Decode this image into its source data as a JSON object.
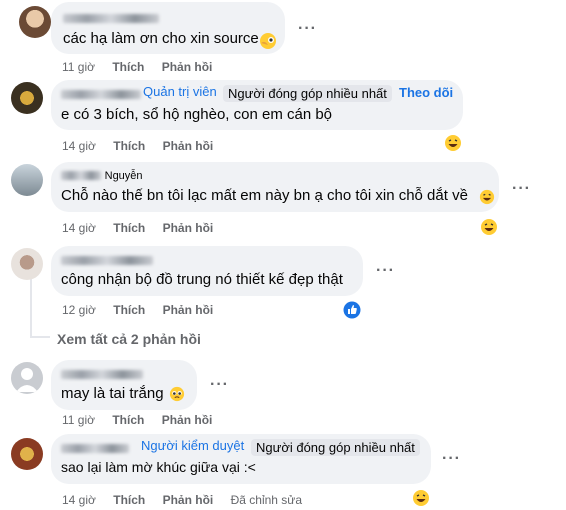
{
  "comments": [
    {
      "time": "11 giờ",
      "like": "Thích",
      "reply": "Phản hồi",
      "text": "các hạ làm ơn cho xin source"
    },
    {
      "time": "14 giờ",
      "like": "Thích",
      "reply": "Phản hồi",
      "admin": "Quản trị viên",
      "top": "Người đóng góp nhiều nhất",
      "follow": "Theo dõi",
      "text": "e có 3 bích, sổ hộ nghèo, con em cán bộ"
    },
    {
      "time": "14 giờ",
      "like": "Thích",
      "reply": "Phản hồi",
      "name": "Nguyễn",
      "text": "Chỗ nào thế bn tôi lạc mất em này bn ạ cho tôi xin chỗ dắt về"
    },
    {
      "time": "12 giờ",
      "like": "Thích",
      "reply": "Phản hồi",
      "text": "công nhận bộ đồ trung nó thiết kế đẹp thật"
    },
    {
      "time": "11 giờ",
      "like": "Thích",
      "reply": "Phản hồi",
      "text": "may là tai trắng"
    },
    {
      "time": "14 giờ",
      "like": "Thích",
      "reply": "Phản hồi",
      "moderator": "Người kiểm duyệt",
      "top": "Người đóng góp nhiều nhất",
      "text": "sao lại làm mờ khúc giữa vại :<",
      "edited": "Đã chỉnh sửa"
    }
  ],
  "view_replies": "Xem tất cả 2 phản hồi",
  "icons": {
    "more": "more-options-icon",
    "like_reaction": "like-reaction-icon",
    "haha": "laughing-emoji-icon",
    "pleading": "pleading-emoji-icon",
    "peek": "peeking-face-emoji-icon"
  },
  "colors": {
    "accent": "#1b74e4",
    "bubble": "#f0f2f5",
    "meta": "#65676b"
  }
}
